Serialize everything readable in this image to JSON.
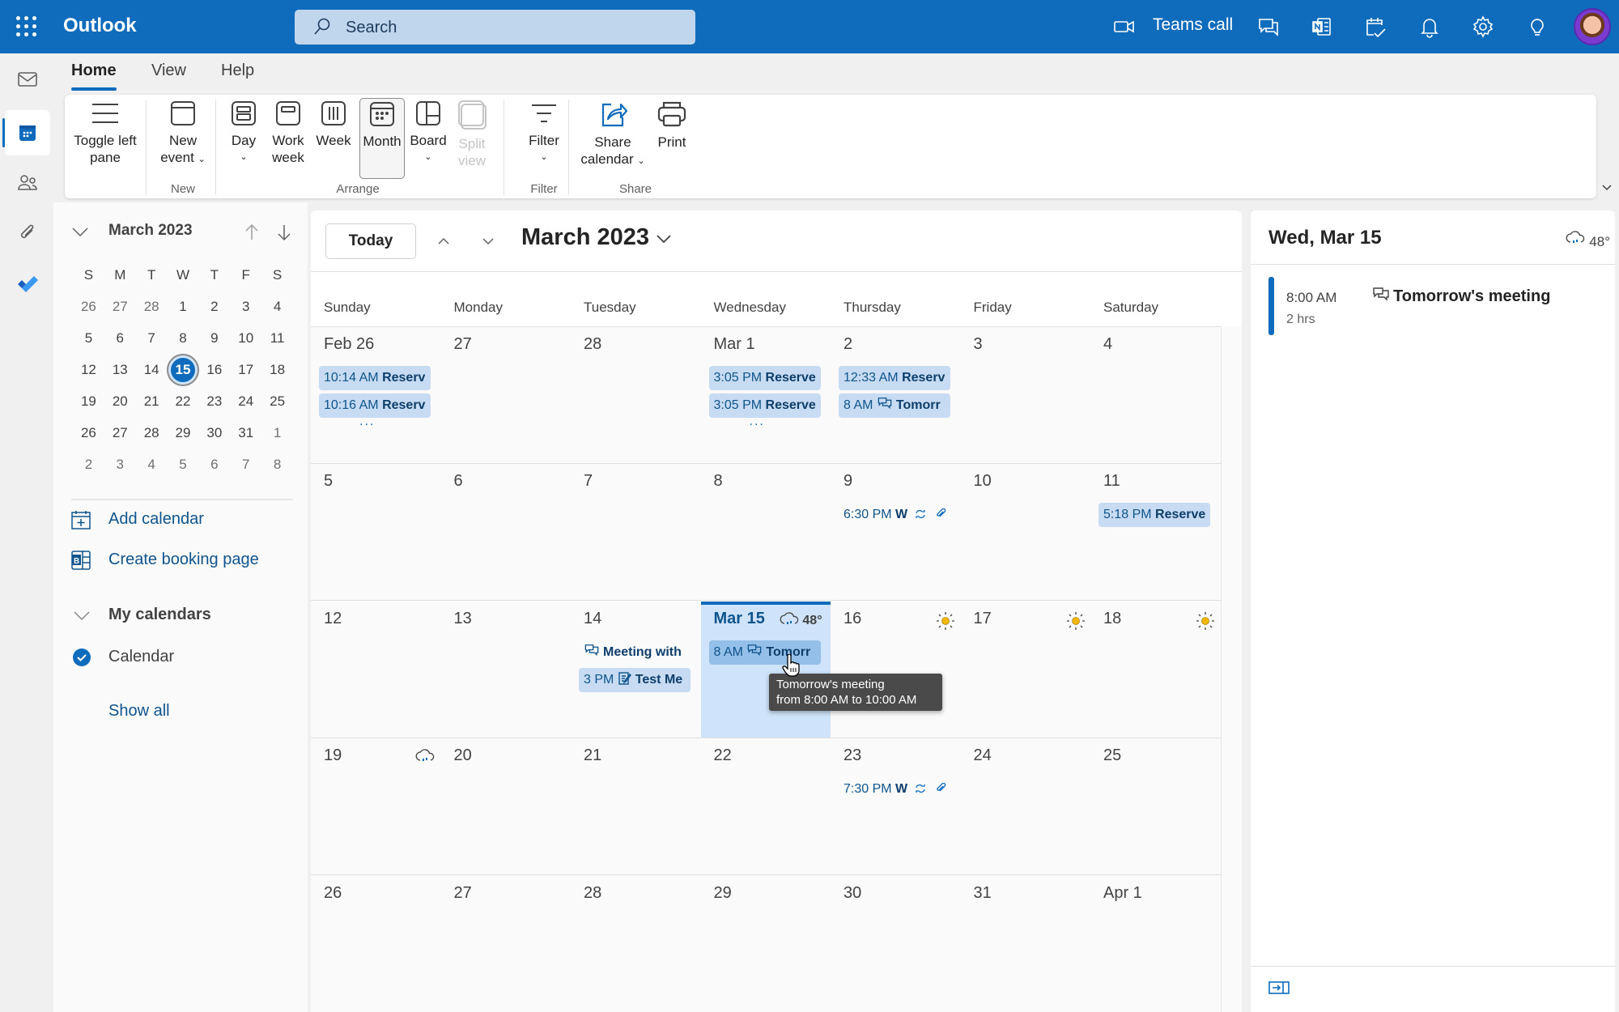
{
  "app": {
    "title": "Outlook"
  },
  "search": {
    "placeholder": "Search"
  },
  "topbar": {
    "teams_call": "Teams call",
    "icons": [
      "video-camera-icon",
      "chat-icon",
      "onenote-icon",
      "calendar-check-icon",
      "bell-icon",
      "gear-icon",
      "lightbulb-icon",
      "avatar"
    ]
  },
  "rail": {
    "items": [
      "mail",
      "calendar",
      "people",
      "files",
      "todo"
    ],
    "active": "calendar"
  },
  "ribbon": {
    "tabs": [
      {
        "label": "Home",
        "active": true
      },
      {
        "label": "View"
      },
      {
        "label": "Help"
      }
    ],
    "toggle_left": {
      "line1": "Toggle left",
      "line2": "pane"
    },
    "new_event": {
      "line1": "New",
      "line2": "event"
    },
    "day": "Day",
    "work_week": {
      "line1": "Work",
      "line2": "week"
    },
    "week": "Week",
    "month": "Month",
    "board": "Board",
    "split_view": {
      "line1": "Split",
      "line2": "view"
    },
    "filter": "Filter",
    "share_calendar": {
      "line1": "Share",
      "line2": "calendar"
    },
    "print": "Print",
    "groups": {
      "new": "New",
      "arrange": "Arrange",
      "filter": "Filter",
      "share": "Share"
    }
  },
  "mini_calendar": {
    "title": "March 2023",
    "dow": [
      "S",
      "M",
      "T",
      "W",
      "T",
      "F",
      "S"
    ],
    "weeks": [
      [
        "26",
        "27",
        "28",
        "1",
        "2",
        "3",
        "4"
      ],
      [
        "5",
        "6",
        "7",
        "8",
        "9",
        "10",
        "11"
      ],
      [
        "12",
        "13",
        "14",
        "15",
        "16",
        "17",
        "18"
      ],
      [
        "19",
        "20",
        "21",
        "22",
        "23",
        "24",
        "25"
      ],
      [
        "26",
        "27",
        "28",
        "29",
        "30",
        "31",
        "1"
      ],
      [
        "2",
        "3",
        "4",
        "5",
        "6",
        "7",
        "8"
      ]
    ],
    "today": "15"
  },
  "pane": {
    "add_calendar": "Add calendar",
    "create_booking": "Create booking page",
    "my_calendars": "My calendars",
    "calendar": "Calendar",
    "show_all": "Show all"
  },
  "main": {
    "today_button": "Today",
    "title": "March 2023",
    "dow": [
      "Sunday",
      "Monday",
      "Tuesday",
      "Wednesday",
      "Thursday",
      "Friday",
      "Saturday"
    ],
    "weeks": [
      {
        "days": [
          {
            "label": "Feb 26",
            "events": [
              {
                "time": "10:14 AM",
                "title": "Reserv"
              },
              {
                "time": "10:16 AM",
                "title": "Reserv"
              }
            ],
            "more": "..."
          },
          {
            "label": "27"
          },
          {
            "label": "28"
          },
          {
            "label": "Mar 1",
            "events": [
              {
                "time": "3:05 PM",
                "title": "Reserve"
              },
              {
                "time": "3:05 PM",
                "title": "Reserve"
              }
            ],
            "more": "..."
          },
          {
            "label": "2",
            "events": [
              {
                "time": "12:33 AM",
                "title": "Reserv"
              },
              {
                "time": "8 AM",
                "icon": "chat",
                "title": "Tomorr"
              }
            ]
          },
          {
            "label": "3"
          },
          {
            "label": "4"
          }
        ]
      },
      {
        "days": [
          {
            "label": "5"
          },
          {
            "label": "6"
          },
          {
            "label": "7"
          },
          {
            "label": "8"
          },
          {
            "label": "9",
            "events": [
              {
                "time": "6:30 PM",
                "title": "W",
                "plain": true,
                "recurring": true,
                "attachment": true
              }
            ]
          },
          {
            "label": "10"
          },
          {
            "label": "11",
            "events": [
              {
                "time": "5:18 PM",
                "title": "Reserve"
              }
            ]
          }
        ]
      },
      {
        "days": [
          {
            "label": "12"
          },
          {
            "label": "13"
          },
          {
            "label": "14",
            "events": [
              {
                "time": "",
                "icon": "chat",
                "title": "Meeting with",
                "plain": true
              },
              {
                "time": "3 PM",
                "icon": "notes",
                "title": "Test Me"
              }
            ]
          },
          {
            "label": "Mar 15",
            "selected": true,
            "weather": "48°",
            "weather_icon": "rain",
            "events": [
              {
                "time": "8 AM",
                "icon": "chat",
                "title": "Tomorr",
                "hover": true
              }
            ]
          },
          {
            "label": "16",
            "weather_icon": "sun"
          },
          {
            "label": "17",
            "weather_icon": "sun"
          },
          {
            "label": "18",
            "weather_icon": "sun"
          }
        ]
      },
      {
        "days": [
          {
            "label": "19",
            "weather_icon": "rain"
          },
          {
            "label": "20"
          },
          {
            "label": "21"
          },
          {
            "label": "22"
          },
          {
            "label": "23",
            "events": [
              {
                "time": "7:30 PM",
                "title": "W",
                "plain": true,
                "recurring": true,
                "attachment": true
              }
            ]
          },
          {
            "label": "24"
          },
          {
            "label": "25"
          }
        ]
      },
      {
        "days": [
          {
            "label": "26"
          },
          {
            "label": "27"
          },
          {
            "label": "28"
          },
          {
            "label": "29"
          },
          {
            "label": "30"
          },
          {
            "label": "31"
          },
          {
            "label": "Apr 1"
          }
        ]
      }
    ],
    "tooltip": {
      "line1": "Tomorrow's meeting",
      "line2": "from 8:00 AM to 10:00 AM"
    }
  },
  "agenda": {
    "title": "Wed, Mar 15",
    "weather": "48°",
    "event": {
      "time": "8:00 AM",
      "duration": "2 hrs",
      "title": "Tomorrow's meeting"
    }
  },
  "colors": {
    "brand": "#0f6cbd",
    "event_bg": "#c7dcf2",
    "selected_day": "#cfe4fa",
    "sun": "#f2b600"
  }
}
